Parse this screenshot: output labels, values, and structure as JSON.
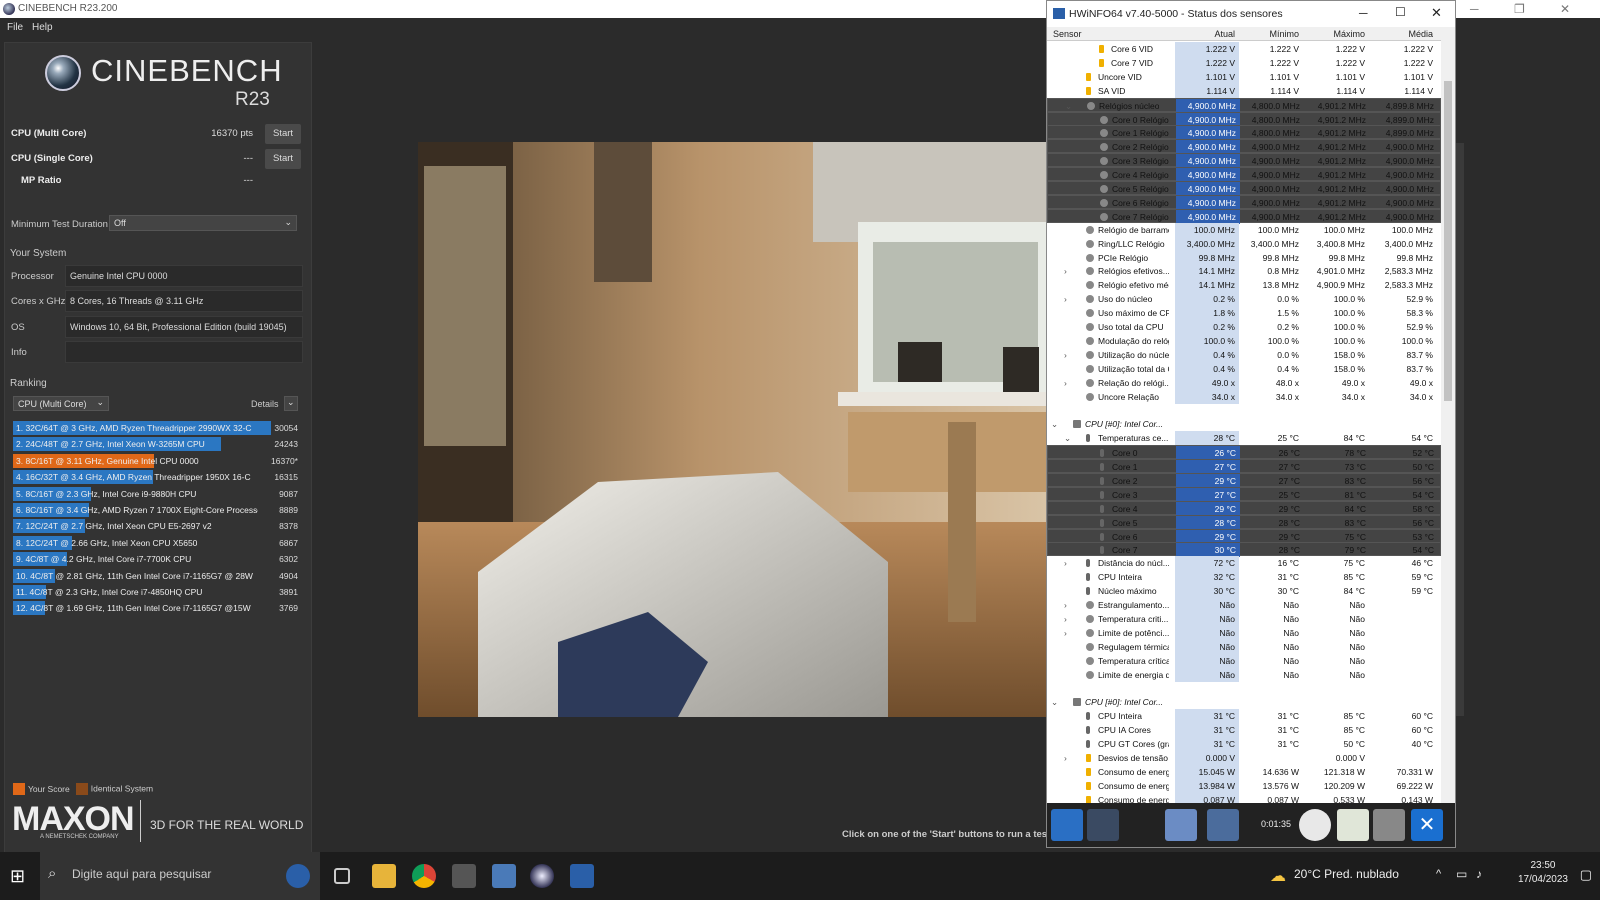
{
  "cinebench": {
    "title": "CINEBENCH R23.200",
    "menu": [
      "File",
      "Help"
    ],
    "logo_name": "CINEBENCH",
    "logo_version": "R23",
    "multi_label": "CPU (Multi Core)",
    "multi_value": "16370 pts",
    "single_label": "CPU (Single Core)",
    "single_value": "---",
    "mp_label": "MP Ratio",
    "mp_value": "---",
    "start_label": "Start",
    "min_test_label": "Minimum Test Duration",
    "min_test_value": "Off",
    "your_system_label": "Your System",
    "processor_label": "Processor",
    "processor_value": "Genuine Intel CPU 0000",
    "cores_label": "Cores x GHz",
    "cores_value": "8 Cores, 16 Threads @ 3.11 GHz",
    "os_label": "OS",
    "os_value": "Windows 10, 64 Bit, Professional Edition (build 19045)",
    "info_label": "Info",
    "info_value": "",
    "ranking_label": "Ranking",
    "ranking_select": "CPU (Multi Core)",
    "details_label": "Details",
    "ranking": [
      {
        "text": "1. 32C/64T @ 3 GHz, AMD Ryzen Threadripper 2990WX 32-C",
        "score": "30054",
        "pct": 1.0,
        "you": false
      },
      {
        "text": "2. 24C/48T @ 2.7 GHz, Intel Xeon W-3265M CPU",
        "score": "24243",
        "pct": 0.807,
        "you": false
      },
      {
        "text": "3. 8C/16T @ 3.11 GHz, Genuine Intel CPU 0000",
        "score": "16370*",
        "pct": 0.545,
        "you": true
      },
      {
        "text": "4. 16C/32T @ 3.4 GHz, AMD Ryzen Threadripper 1950X 16-C",
        "score": "16315",
        "pct": 0.543,
        "you": false
      },
      {
        "text": "5. 8C/16T @ 2.3 GHz, Intel Core i9-9880H CPU",
        "score": "9087",
        "pct": 0.302,
        "you": false
      },
      {
        "text": "6. 8C/16T @ 3.4 GHz, AMD Ryzen 7 1700X Eight-Core Processo",
        "score": "8889",
        "pct": 0.296,
        "you": false
      },
      {
        "text": "7. 12C/24T @ 2.7 GHz, Intel Xeon CPU E5-2697 v2",
        "score": "8378",
        "pct": 0.279,
        "you": false
      },
      {
        "text": "8. 12C/24T @ 2.66 GHz, Intel Xeon CPU X5650",
        "score": "6867",
        "pct": 0.228,
        "you": false
      },
      {
        "text": "9. 4C/8T @ 4.2 GHz, Intel Core i7-7700K CPU",
        "score": "6302",
        "pct": 0.21,
        "you": false
      },
      {
        "text": "10. 4C/8T @ 2.81 GHz, 11th Gen Intel Core i7-1165G7 @ 28W",
        "score": "4904",
        "pct": 0.163,
        "you": false
      },
      {
        "text": "11. 4C/8T @ 2.3 GHz, Intel Core i7-4850HQ CPU",
        "score": "3891",
        "pct": 0.129,
        "you": false
      },
      {
        "text": "12. 4C/8T @ 1.69 GHz, 11th Gen Intel Core i7-1165G7 @15W",
        "score": "3769",
        "pct": 0.125,
        "you": false
      }
    ],
    "legend_your": "Your Score",
    "legend_identical": "Identical System",
    "maxon": "MAXON",
    "maxon_sub": "A NEMETSCHEK COMPANY",
    "tagline": "3D FOR THE REAL WORLD",
    "hint": "Click on one of the 'Start' buttons to run a test.",
    "colors": {
      "your_score": "#e06818",
      "identical": "#8a4a1a",
      "bar": "#2b77c2"
    }
  },
  "hwinfo": {
    "title": "HWiNFO64 v7.40-5000 - Status dos sensores",
    "columns": [
      "Sensor",
      "Atual",
      "Mínimo",
      "Máximo",
      "Média"
    ],
    "timer": "0:01:35",
    "rows": [
      {
        "n": "Core 6 VID",
        "c": "1.222 V",
        "mi": "1.222 V",
        "ma": "1.222 V",
        "av": "1.222 V",
        "ind": 2,
        "ic": "bolt"
      },
      {
        "n": "Core 7 VID",
        "c": "1.222 V",
        "mi": "1.222 V",
        "ma": "1.222 V",
        "av": "1.222 V",
        "ind": 2,
        "ic": "bolt"
      },
      {
        "n": "Uncore VID",
        "c": "1.101 V",
        "mi": "1.101 V",
        "ma": "1.101 V",
        "av": "1.101 V",
        "ind": 1,
        "ic": "bolt"
      },
      {
        "n": "SA VID",
        "c": "1.114 V",
        "mi": "1.114 V",
        "ma": "1.114 V",
        "av": "1.114 V",
        "ind": 1,
        "ic": "bolt"
      },
      {
        "n": "Relógios núcleo",
        "c": "4,900.0 MHz",
        "mi": "4,800.0 MHz",
        "ma": "4,901.2 MHz",
        "av": "4,899.8 MHz",
        "ind": 1,
        "ic": "clock",
        "exp": "v",
        "sel": true
      },
      {
        "n": "Core 0 Relógio",
        "c": "4,900.0 MHz",
        "mi": "4,800.0 MHz",
        "ma": "4,901.2 MHz",
        "av": "4,899.0 MHz",
        "ind": 2,
        "ic": "clock",
        "sel": true
      },
      {
        "n": "Core 1 Relógio",
        "c": "4,900.0 MHz",
        "mi": "4,800.0 MHz",
        "ma": "4,901.2 MHz",
        "av": "4,899.0 MHz",
        "ind": 2,
        "ic": "clock",
        "sel": true
      },
      {
        "n": "Core 2 Relógio",
        "c": "4,900.0 MHz",
        "mi": "4,900.0 MHz",
        "ma": "4,901.2 MHz",
        "av": "4,900.0 MHz",
        "ind": 2,
        "ic": "clock",
        "sel": true
      },
      {
        "n": "Core 3 Relógio",
        "c": "4,900.0 MHz",
        "mi": "4,900.0 MHz",
        "ma": "4,901.2 MHz",
        "av": "4,900.0 MHz",
        "ind": 2,
        "ic": "clock",
        "sel": true
      },
      {
        "n": "Core 4 Relógio",
        "c": "4,900.0 MHz",
        "mi": "4,900.0 MHz",
        "ma": "4,901.2 MHz",
        "av": "4,900.0 MHz",
        "ind": 2,
        "ic": "clock",
        "sel": true
      },
      {
        "n": "Core 5 Relógio",
        "c": "4,900.0 MHz",
        "mi": "4,900.0 MHz",
        "ma": "4,901.2 MHz",
        "av": "4,900.0 MHz",
        "ind": 2,
        "ic": "clock",
        "sel": true
      },
      {
        "n": "Core 6 Relógio",
        "c": "4,900.0 MHz",
        "mi": "4,900.0 MHz",
        "ma": "4,901.2 MHz",
        "av": "4,900.0 MHz",
        "ind": 2,
        "ic": "clock",
        "sel": true
      },
      {
        "n": "Core 7 Relógio",
        "c": "4,900.0 MHz",
        "mi": "4,900.0 MHz",
        "ma": "4,901.2 MHz",
        "av": "4,900.0 MHz",
        "ind": 2,
        "ic": "clock",
        "sel": true
      },
      {
        "n": "Relógio de barramento",
        "c": "100.0 MHz",
        "mi": "100.0 MHz",
        "ma": "100.0 MHz",
        "av": "100.0 MHz",
        "ind": 1,
        "ic": "clock"
      },
      {
        "n": "Ring/LLC Relógio",
        "c": "3,400.0 MHz",
        "mi": "3,400.0 MHz",
        "ma": "3,400.8 MHz",
        "av": "3,400.0 MHz",
        "ind": 1,
        "ic": "clock"
      },
      {
        "n": "PCIe Relógio",
        "c": "99.8 MHz",
        "mi": "99.8 MHz",
        "ma": "99.8 MHz",
        "av": "99.8 MHz",
        "ind": 1,
        "ic": "clock"
      },
      {
        "n": "Relógios efetivos...",
        "c": "14.1 MHz",
        "mi": "0.8 MHz",
        "ma": "4,901.0 MHz",
        "av": "2,583.3 MHz",
        "ind": 1,
        "ic": "clock",
        "exp": ">"
      },
      {
        "n": "Relógio efetivo médio",
        "c": "14.1 MHz",
        "mi": "13.8 MHz",
        "ma": "4,900.9 MHz",
        "av": "2,583.3 MHz",
        "ind": 1,
        "ic": "clock"
      },
      {
        "n": "Uso do núcleo",
        "c": "0.2 %",
        "mi": "0.0 %",
        "ma": "100.0 %",
        "av": "52.9 %",
        "ind": 1,
        "ic": "clock",
        "exp": ">"
      },
      {
        "n": "Uso máximo de CPU ...",
        "c": "1.8 %",
        "mi": "1.5 %",
        "ma": "100.0 %",
        "av": "58.3 %",
        "ind": 1,
        "ic": "clock"
      },
      {
        "n": "Uso total da CPU",
        "c": "0.2 %",
        "mi": "0.2 %",
        "ma": "100.0 %",
        "av": "52.9 %",
        "ind": 1,
        "ic": "clock"
      },
      {
        "n": "Modulação do relógi...",
        "c": "100.0 %",
        "mi": "100.0 %",
        "ma": "100.0 %",
        "av": "100.0 %",
        "ind": 1,
        "ic": "clock"
      },
      {
        "n": "Utilização do núcleo",
        "c": "0.4 %",
        "mi": "0.0 %",
        "ma": "158.0 %",
        "av": "83.7 %",
        "ind": 1,
        "ic": "clock",
        "exp": ">"
      },
      {
        "n": "Utilização total da CPU",
        "c": "0.4 %",
        "mi": "0.4 %",
        "ma": "158.0 %",
        "av": "83.7 %",
        "ind": 1,
        "ic": "clock"
      },
      {
        "n": "Relação do relógi...",
        "c": "49.0 x",
        "mi": "48.0 x",
        "ma": "49.0 x",
        "av": "49.0 x",
        "ind": 1,
        "ic": "clock",
        "exp": ">"
      },
      {
        "n": "Uncore Relação",
        "c": "34.0 x",
        "mi": "34.0 x",
        "ma": "34.0 x",
        "av": "34.0 x",
        "ind": 1,
        "ic": "clock"
      },
      {
        "n": "",
        "c": "",
        "mi": "",
        "ma": "",
        "av": "",
        "ind": 0,
        "ic": "none",
        "blank": true
      },
      {
        "n": "CPU [#0]: Intel Cor...",
        "c": "",
        "mi": "",
        "ma": "",
        "av": "",
        "ind": 0,
        "ic": "chip",
        "exp": "v",
        "group": true
      },
      {
        "n": "Temperaturas ce...",
        "c": "28 °C",
        "mi": "25 °C",
        "ma": "84 °C",
        "av": "54 °C",
        "ind": 1,
        "ic": "therm",
        "exp": "v"
      },
      {
        "n": "Core 0",
        "c": "26 °C",
        "mi": "26 °C",
        "ma": "78 °C",
        "av": "52 °C",
        "ind": 2,
        "ic": "therm",
        "sel": true
      },
      {
        "n": "Core 1",
        "c": "27 °C",
        "mi": "27 °C",
        "ma": "73 °C",
        "av": "50 °C",
        "ind": 2,
        "ic": "therm",
        "sel": true
      },
      {
        "n": "Core 2",
        "c": "29 °C",
        "mi": "27 °C",
        "ma": "83 °C",
        "av": "56 °C",
        "ind": 2,
        "ic": "therm",
        "sel": true
      },
      {
        "n": "Core 3",
        "c": "27 °C",
        "mi": "25 °C",
        "ma": "81 °C",
        "av": "54 °C",
        "ind": 2,
        "ic": "therm",
        "sel": true
      },
      {
        "n": "Core 4",
        "c": "29 °C",
        "mi": "29 °C",
        "ma": "84 °C",
        "av": "58 °C",
        "ind": 2,
        "ic": "therm",
        "sel": true
      },
      {
        "n": "Core 5",
        "c": "28 °C",
        "mi": "28 °C",
        "ma": "83 °C",
        "av": "56 °C",
        "ind": 2,
        "ic": "therm",
        "sel": true
      },
      {
        "n": "Core 6",
        "c": "29 °C",
        "mi": "29 °C",
        "ma": "75 °C",
        "av": "53 °C",
        "ind": 2,
        "ic": "therm",
        "sel": true
      },
      {
        "n": "Core 7",
        "c": "30 °C",
        "mi": "28 °C",
        "ma": "79 °C",
        "av": "54 °C",
        "ind": 2,
        "ic": "therm",
        "sel": true
      },
      {
        "n": "Distância do núcl...",
        "c": "72 °C",
        "mi": "16 °C",
        "ma": "75 °C",
        "av": "46 °C",
        "ind": 1,
        "ic": "therm",
        "exp": ">"
      },
      {
        "n": "CPU Inteira",
        "c": "32 °C",
        "mi": "31 °C",
        "ma": "85 °C",
        "av": "59 °C",
        "ind": 1,
        "ic": "therm"
      },
      {
        "n": "Núcleo máximo",
        "c": "30 °C",
        "mi": "30 °C",
        "ma": "84 °C",
        "av": "59 °C",
        "ind": 1,
        "ic": "therm"
      },
      {
        "n": "Estrangulamento...",
        "c": "Não",
        "mi": "Não",
        "ma": "Não",
        "av": "",
        "ind": 1,
        "ic": "clock",
        "exp": ">"
      },
      {
        "n": "Temperatura criti...",
        "c": "Não",
        "mi": "Não",
        "ma": "Não",
        "av": "",
        "ind": 1,
        "ic": "clock",
        "exp": ">"
      },
      {
        "n": "Limite de potênci...",
        "c": "Não",
        "mi": "Não",
        "ma": "Não",
        "av": "",
        "ind": 1,
        "ic": "clock",
        "exp": ">"
      },
      {
        "n": "Regulagem térmica ...",
        "c": "Não",
        "mi": "Não",
        "ma": "Não",
        "av": "",
        "ind": 1,
        "ic": "clock"
      },
      {
        "n": "Temperatura crítica ...",
        "c": "Não",
        "mi": "Não",
        "ma": "Não",
        "av": "",
        "ind": 1,
        "ic": "clock"
      },
      {
        "n": "Limite de energia do ...",
        "c": "Não",
        "mi": "Não",
        "ma": "Não",
        "av": "",
        "ind": 1,
        "ic": "clock"
      },
      {
        "n": "",
        "c": "",
        "mi": "",
        "ma": "",
        "av": "",
        "ind": 0,
        "ic": "none",
        "blank": true
      },
      {
        "n": "CPU [#0]: Intel Cor...",
        "c": "",
        "mi": "",
        "ma": "",
        "av": "",
        "ind": 0,
        "ic": "chip",
        "exp": "v",
        "group": true
      },
      {
        "n": "CPU Inteira",
        "c": "31 °C",
        "mi": "31 °C",
        "ma": "85 °C",
        "av": "60 °C",
        "ind": 1,
        "ic": "therm"
      },
      {
        "n": "CPU IA Cores",
        "c": "31 °C",
        "mi": "31 °C",
        "ma": "85 °C",
        "av": "60 °C",
        "ind": 1,
        "ic": "therm"
      },
      {
        "n": "CPU GT Cores (gráfi...",
        "c": "31 °C",
        "mi": "31 °C",
        "ma": "50 °C",
        "av": "40 °C",
        "ind": 1,
        "ic": "therm"
      },
      {
        "n": "Desvios de tensão",
        "c": "0.000 V",
        "mi": "",
        "ma": "0.000 V",
        "av": "",
        "ind": 1,
        "ic": "bolt",
        "exp": ">"
      },
      {
        "n": "Consumo de energia...",
        "c": "15.045 W",
        "mi": "14.636 W",
        "ma": "121.318 W",
        "av": "70.331 W",
        "ind": 1,
        "ic": "bolt"
      },
      {
        "n": "Consumo de energia...",
        "c": "13.984 W",
        "mi": "13.576 W",
        "ma": "120.209 W",
        "av": "69.222 W",
        "ind": 1,
        "ic": "bolt"
      },
      {
        "n": "Consumo de energia...",
        "c": "0.087 W",
        "mi": "0.087 W",
        "ma": "0.533 W",
        "av": "0.143 W",
        "ind": 1,
        "ic": "bolt"
      }
    ]
  },
  "taskbar": {
    "search_placeholder": "Digite aqui para pesquisar",
    "weather": "20°C  Pred. nublado",
    "time": "23:50",
    "date": "17/04/2023"
  }
}
